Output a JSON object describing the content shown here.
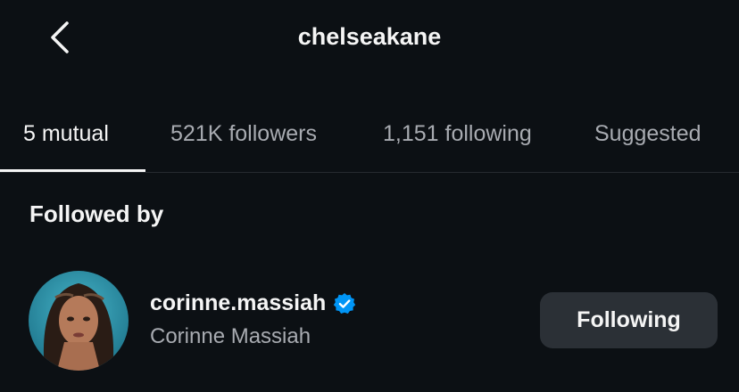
{
  "header": {
    "title": "chelseakane",
    "back_icon": "chevron-left-icon"
  },
  "tabs": [
    {
      "label": "5 mutual",
      "active": true
    },
    {
      "label": "521K followers",
      "active": false
    },
    {
      "label": "1,151 following",
      "active": false
    },
    {
      "label": "Suggested",
      "active": false
    }
  ],
  "section": {
    "title": "Followed by"
  },
  "users": [
    {
      "username": "corinne.massiah",
      "full_name": "Corinne Massiah",
      "verified": true,
      "verified_icon": "verified-badge-icon",
      "button_label": "Following"
    }
  ],
  "colors": {
    "background": "#0c1014",
    "primary_text": "#f5f5f5",
    "secondary_text": "#a8abb1",
    "button_bg": "#2b3036",
    "verified_blue": "#0095f6",
    "divider": "#262a30"
  }
}
